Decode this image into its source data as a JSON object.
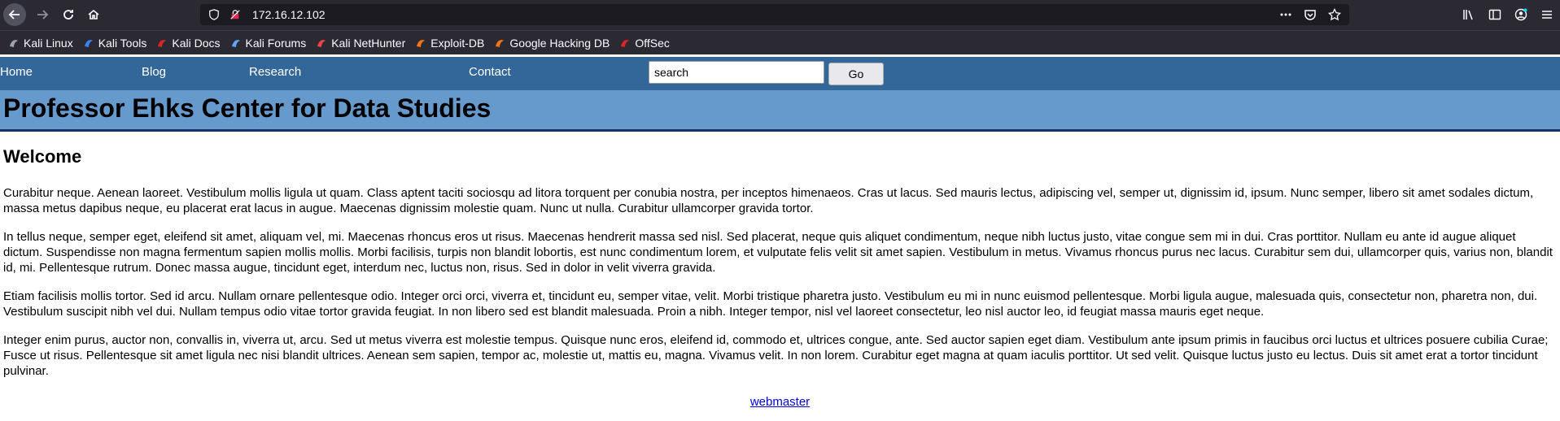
{
  "browser": {
    "url": "172.16.12.102"
  },
  "bookmarks": [
    {
      "label": "Kali Linux",
      "icon": "kali-dragon-icon",
      "color": "#9aa5b1"
    },
    {
      "label": "Kali Tools",
      "icon": "kali-tools-icon",
      "color": "#3b82f6"
    },
    {
      "label": "Kali Docs",
      "icon": "kali-docs-icon",
      "color": "#dc2626"
    },
    {
      "label": "Kali Forums",
      "icon": "kali-forums-icon",
      "color": "#60a5fa"
    },
    {
      "label": "Kali NetHunter",
      "icon": "nethunter-icon",
      "color": "#ef4444"
    },
    {
      "label": "Exploit-DB",
      "icon": "exploit-db-icon",
      "color": "#f97316"
    },
    {
      "label": "Google Hacking DB",
      "icon": "ghdb-icon",
      "color": "#f97316"
    },
    {
      "label": "OffSec",
      "icon": "offsec-icon",
      "color": "#dc2626"
    }
  ],
  "nav": {
    "items": [
      "Home",
      "Blog",
      "Research",
      "Contact"
    ],
    "search_value": "search",
    "go_label": "Go"
  },
  "site": {
    "title": "Professor Ehks Center for Data Studies"
  },
  "main": {
    "heading": "Welcome",
    "paragraphs": [
      "Curabitur neque. Aenean laoreet. Vestibulum mollis ligula ut quam. Class aptent taciti sociosqu ad litora torquent per conubia nostra, per inceptos himenaeos. Cras ut lacus. Sed mauris lectus, adipiscing vel, semper ut, dignissim id, ipsum. Nunc semper, libero sit amet sodales dictum, massa metus dapibus neque, eu placerat erat lacus in augue. Maecenas dignissim molestie quam. Nunc ut nulla. Curabitur ullamcorper gravida tortor.",
      "In tellus neque, semper eget, eleifend sit amet, aliquam vel, mi. Maecenas rhoncus eros ut risus. Maecenas hendrerit massa sed nisl. Sed placerat, neque quis aliquet condimentum, neque nibh luctus justo, vitae congue sem mi in dui. Cras porttitor. Nullam eu ante id augue aliquet dictum. Suspendisse non magna fermentum sapien mollis mollis. Morbi facilisis, turpis non blandit lobortis, est nunc condimentum lorem, et vulputate felis velit sit amet sapien. Vestibulum in metus. Vivamus rhoncus purus nec lacus. Curabitur sem dui, ullamcorper quis, varius non, blandit id, mi. Pellentesque rutrum. Donec massa augue, tincidunt eget, interdum nec, luctus non, risus. Sed in dolor in velit viverra gravida.",
      "Etiam facilisis mollis tortor. Sed id arcu. Nullam ornare pellentesque odio. Integer orci orci, viverra et, tincidunt eu, semper vitae, velit. Morbi tristique pharetra justo. Vestibulum eu mi in nunc euismod pellentesque. Morbi ligula augue, malesuada quis, consectetur non, pharetra non, dui. Vestibulum suscipit nibh vel dui. Nullam tempus odio vitae tortor gravida feugiat. In non libero sed est blandit malesuada. Proin a nibh. Integer tempor, nisl vel laoreet consectetur, leo nisl auctor leo, id feugiat massa mauris eget neque.",
      "Integer enim purus, auctor non, convallis in, viverra ut, arcu. Sed ut metus viverra est molestie tempus. Quisque nunc eros, eleifend id, commodo et, ultrices congue, ante. Sed auctor sapien eget diam. Vestibulum ante ipsum primis in faucibus orci luctus et ultrices posuere cubilia Curae; Fusce ut risus. Pellentesque sit amet ligula nec nisi blandit ultrices. Aenean sem sapien, tempor ac, molestie ut, mattis eu, magna. Vivamus velit. In non lorem. Curabitur eget magna at quam iaculis porttitor. Ut sed velit. Quisque luctus justo eu lectus. Duis sit amet erat a tortor tincidunt pulvinar."
    ]
  },
  "footer": {
    "link": "webmaster"
  },
  "colors": {
    "nav_bg": "#336699",
    "header_bg": "#6699cc",
    "header_border": "#1a3366",
    "browser_chrome": "#2b2a33",
    "link": "#0000ee"
  }
}
